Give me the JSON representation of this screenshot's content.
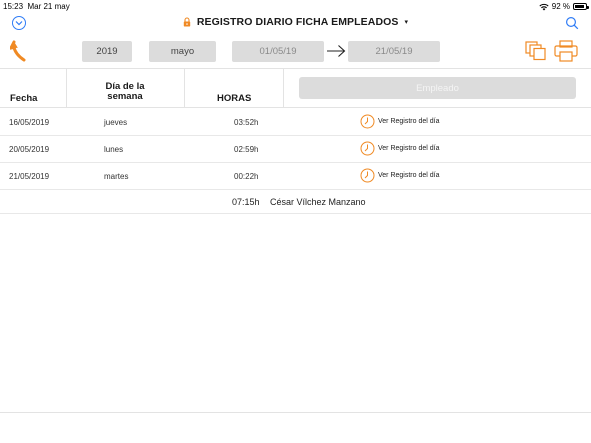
{
  "status_bar": {
    "time": "15:23",
    "date": "Mar 21 may",
    "battery": "92 %",
    "battery_level": 0.92
  },
  "nav": {
    "title": "REGISTRO DIARIO FICHA EMPLEADOS",
    "caret": "▾"
  },
  "filters": {
    "year": "2019",
    "month": "mayo",
    "date_from": "01/05/19",
    "date_to": "21/05/19"
  },
  "table": {
    "headers": {
      "fecha": "Fecha",
      "dia": "Día de la semana",
      "horas": "HORAS"
    },
    "empleado_button": "Empleado",
    "rows": [
      {
        "fecha": "16/05/2019",
        "dia": "jueves",
        "horas": "03:52h",
        "link": "Ver Registro del día"
      },
      {
        "fecha": "20/05/2019",
        "dia": "lunes",
        "horas": "02:59h",
        "link": "Ver Registro del día"
      },
      {
        "fecha": "21/05/2019",
        "dia": "martes",
        "horas": "00:22h",
        "link": "Ver Registro del día"
      }
    ],
    "total": {
      "horas": "07:15h",
      "empleado": "César Vílchez Manzano"
    }
  },
  "colors": {
    "accent_blue": "#2f7cf6",
    "accent_orange": "#f08a24",
    "pill_bg": "#dcdcdc"
  }
}
